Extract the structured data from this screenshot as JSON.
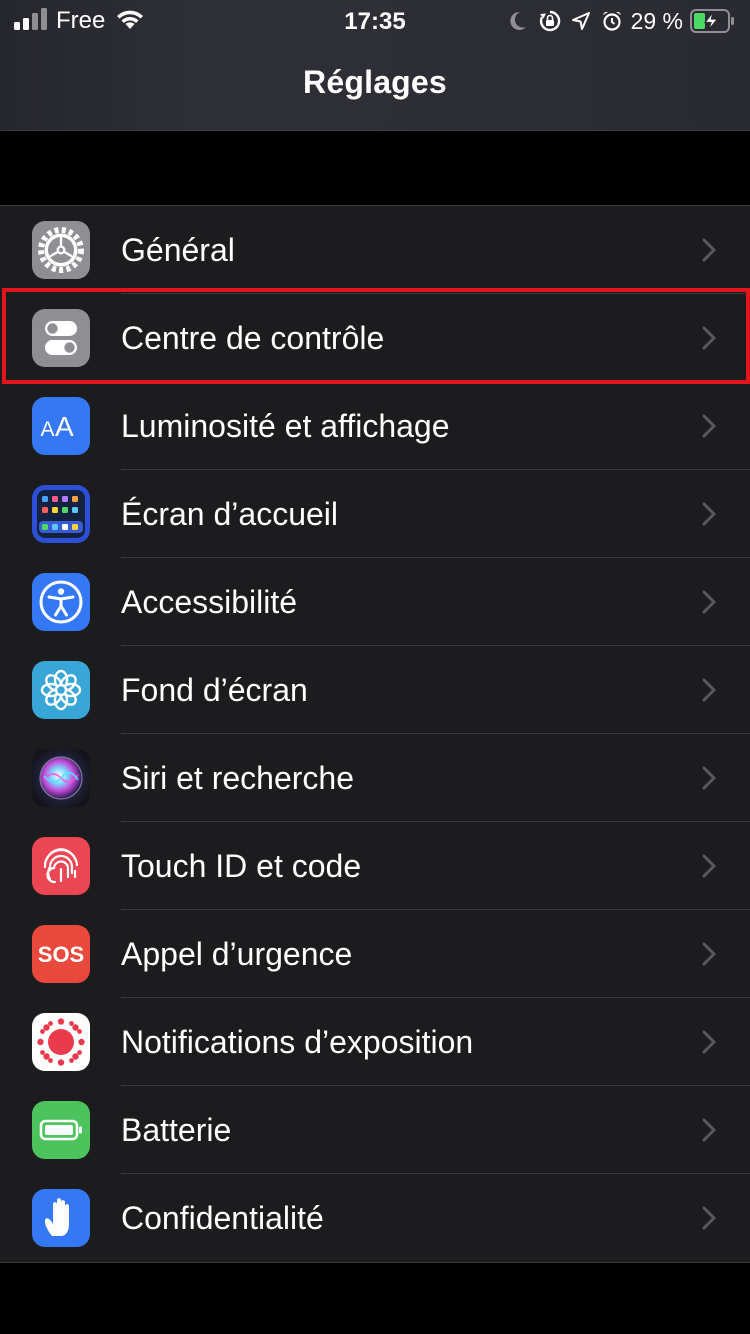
{
  "status_bar": {
    "carrier": "Free",
    "time": "17:35",
    "battery_percent": "29 %",
    "icons": [
      "signal-icon",
      "wifi-icon",
      "moon-icon",
      "orientation-lock-icon",
      "location-icon",
      "alarm-icon",
      "battery-charging-icon"
    ]
  },
  "header": {
    "title": "Réglages"
  },
  "settings": {
    "items": [
      {
        "label": "Général",
        "icon": "gear-icon",
        "color": "#8e8e93"
      },
      {
        "label": "Centre de contrôle",
        "icon": "toggles-icon",
        "color": "#8e8e93",
        "highlighted": true
      },
      {
        "label": "Luminosité et affichage",
        "icon": "text-size-icon",
        "color": "#3478f6"
      },
      {
        "label": "Écran d’accueil",
        "icon": "home-screen-icon",
        "color": "#2c4fd6"
      },
      {
        "label": "Accessibilité",
        "icon": "accessibility-icon",
        "color": "#3478f6"
      },
      {
        "label": "Fond d’écran",
        "icon": "wallpaper-flower-icon",
        "color": "#39a6d8"
      },
      {
        "label": "Siri et recherche",
        "icon": "siri-icon",
        "color": "#222222"
      },
      {
        "label": "Touch ID et code",
        "icon": "fingerprint-icon",
        "color": "#eb4654"
      },
      {
        "label": "Appel d’urgence",
        "icon": "sos-icon",
        "color": "#e9493c"
      },
      {
        "label": "Notifications d’exposition",
        "icon": "exposure-icon",
        "color": "#ffffff"
      },
      {
        "label": "Batterie",
        "icon": "battery-icon",
        "color": "#4cc35c"
      },
      {
        "label": "Confidentialité",
        "icon": "hand-icon",
        "color": "#3478f6"
      }
    ],
    "sos_text": "SOS",
    "aa_text": "AA"
  },
  "highlight_color": "#e3141c"
}
